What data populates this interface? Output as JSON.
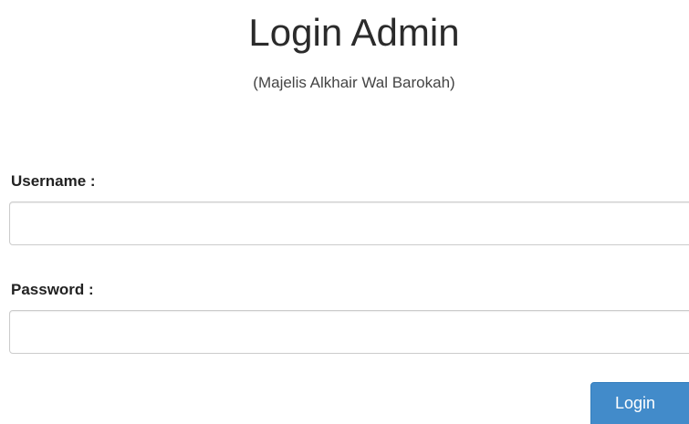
{
  "header": {
    "title": "Login Admin",
    "subtitle": "(Majelis Alkhair Wal Barokah)"
  },
  "form": {
    "username_label": "Username :",
    "username_value": "",
    "password_label": "Password :",
    "password_value": "",
    "submit_label": "Login"
  },
  "colors": {
    "button_background": "#428bca",
    "button_text": "#ffffff",
    "input_border": "#cccccc",
    "title_text": "#2b2b2b"
  }
}
